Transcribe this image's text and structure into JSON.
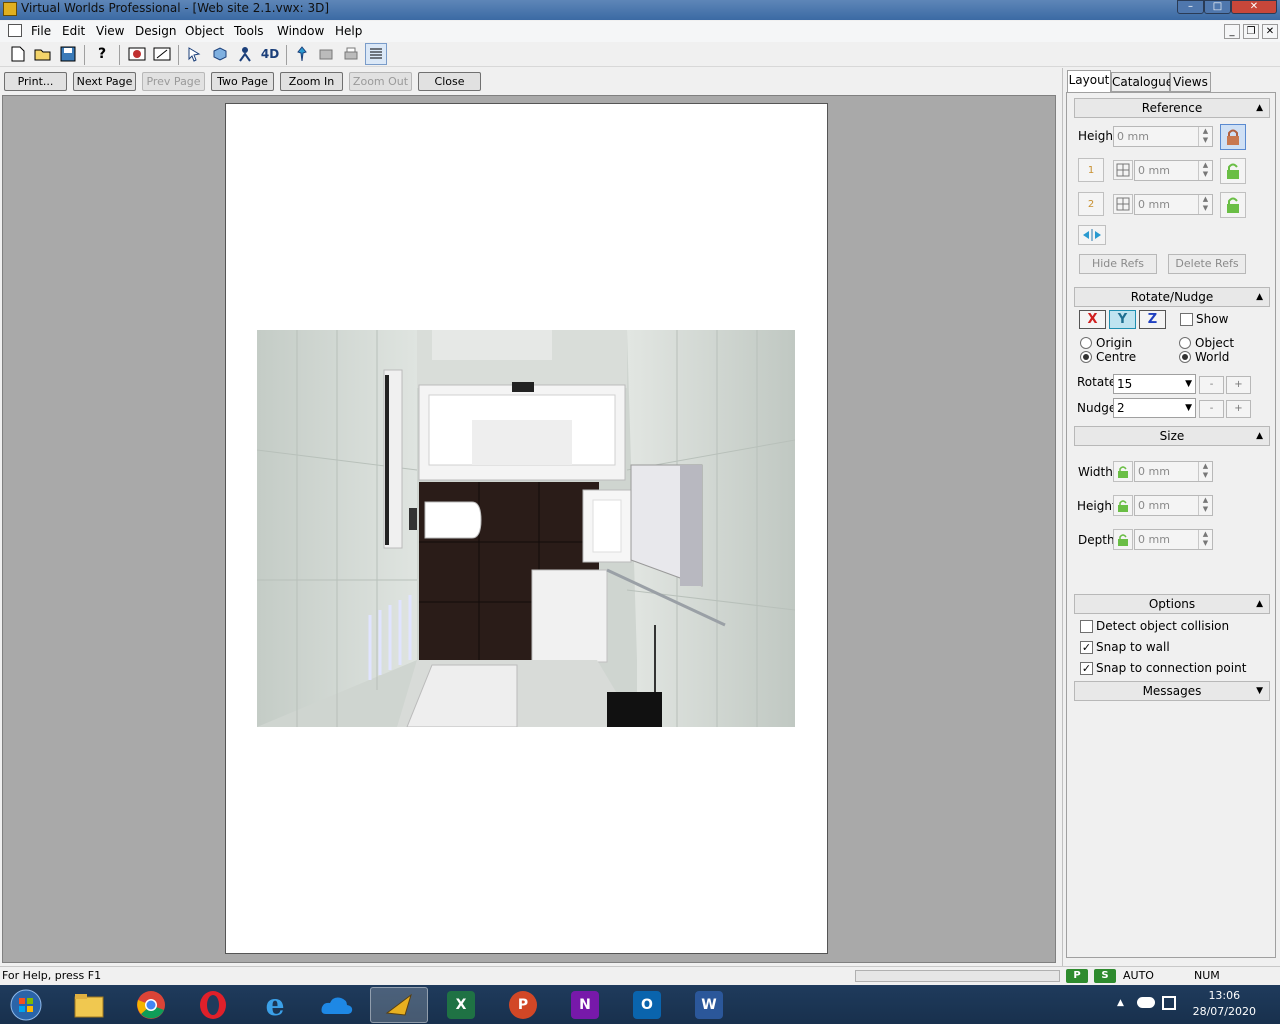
{
  "window": {
    "title": "Virtual Worlds Professional - [Web site 2.1.vwx: 3D]",
    "controls": {
      "minimize": "–",
      "maximize": "□",
      "close": "✕"
    },
    "mdi_controls": {
      "minimize": "_",
      "restore": "❐",
      "close": "✕"
    }
  },
  "menu": {
    "items": [
      "File",
      "Edit",
      "View",
      "Design",
      "Object",
      "Tools",
      "Window",
      "Help"
    ]
  },
  "toolbar": {
    "icons": [
      "new-document-icon",
      "open-folder-icon",
      "save-icon",
      "help-icon",
      "camera-icon",
      "render-icon",
      "select-arrow-icon",
      "object-icon",
      "person-icon",
      "4d-icon",
      "pin-icon",
      "export-icon",
      "print-icon",
      "list-icon"
    ],
    "label_4d": "4D"
  },
  "preview_bar": {
    "print": "Print...",
    "next_page": "Next Page",
    "prev_page": "Prev Page",
    "two_page": "Two Page",
    "zoom_in": "Zoom In",
    "zoom_out": "Zoom Out",
    "close": "Close"
  },
  "panel": {
    "tabs": [
      "Layout",
      "Catalogue",
      "Views"
    ],
    "active_tab": "Layout",
    "reference": {
      "title": "Reference",
      "height_label": "Height",
      "height_value": "0 mm",
      "ref1_value": "0 mm",
      "ref2_value": "0 mm",
      "ref1_num": "1",
      "ref2_num": "2",
      "hide_refs": "Hide Refs",
      "delete_refs": "Delete Refs"
    },
    "rotate": {
      "title": "Rotate/Nudge",
      "axes": [
        "X",
        "Y",
        "Z"
      ],
      "selected_axis": "Y",
      "show_label": "Show",
      "origin": "Origin",
      "object": "Object",
      "centre": "Centre",
      "world": "World",
      "rotate_label": "Rotate",
      "rotate_value": "15",
      "nudge_label": "Nudge",
      "nudge_value": "2",
      "minus": "-",
      "plus": "+"
    },
    "size": {
      "title": "Size",
      "width_label": "Width",
      "width_value": "0 mm",
      "height_label": "Height",
      "height_value": "0 mm",
      "depth_label": "Depth",
      "depth_value": "0 mm"
    },
    "options": {
      "title": "Options",
      "detect_collision": "Detect object collision",
      "snap_wall": "Snap to wall",
      "snap_connection": "Snap to connection point",
      "detect_collision_checked": false,
      "snap_wall_checked": true,
      "snap_connection_checked": true
    },
    "messages": {
      "title": "Messages"
    }
  },
  "status": {
    "help": "For Help, press F1",
    "p_badge": "P",
    "s_badge": "S",
    "auto": "AUTO",
    "num": "NUM"
  },
  "taskbar": {
    "apps": [
      "windows-start-icon",
      "file-explorer-icon",
      "chrome-icon",
      "opera-icon",
      "internet-explorer-icon",
      "onedrive-icon",
      "virtual-worlds-icon",
      "excel-icon",
      "powerpoint-icon",
      "onenote-icon",
      "outlook-icon",
      "word-icon"
    ],
    "glyphs": {
      "excel": "X",
      "powerpoint": "P",
      "onenote": "N",
      "outlook": "O",
      "word": "W"
    },
    "time": "13:06",
    "date": "28/07/2020",
    "tray_up": "▲"
  },
  "colors": {
    "preview_background": "#a9a9a9",
    "axis_x": "#d02020",
    "axis_y": "#1f8fb0",
    "axis_z": "#2040c0",
    "lock_green": "#6abe45"
  }
}
